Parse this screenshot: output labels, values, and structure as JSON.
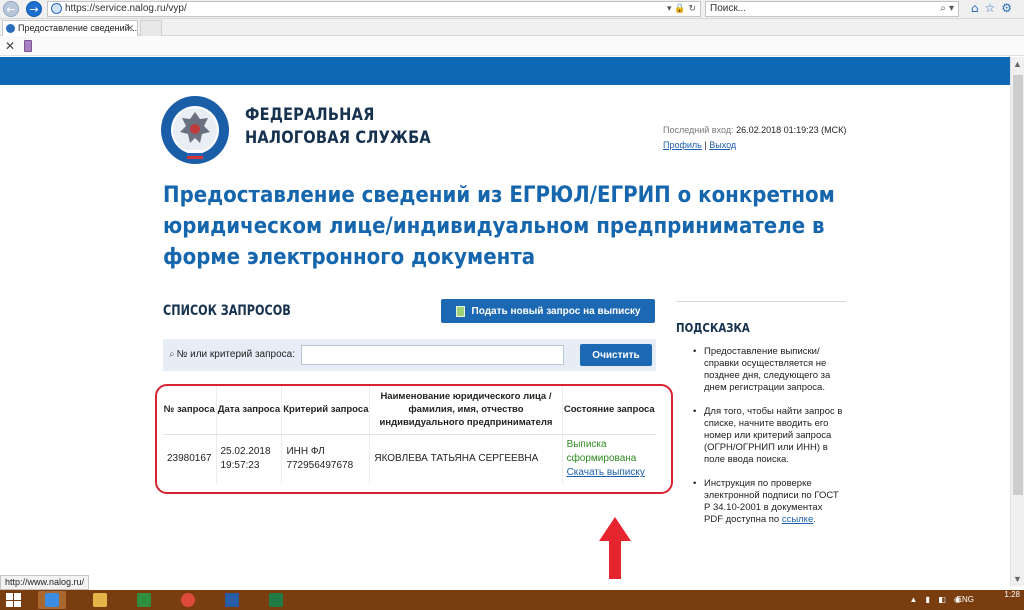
{
  "browser": {
    "url": "https://service.nalog.ru/vyp/",
    "search_placeholder": "Поиск...",
    "tab_title": "Предоставление сведений...",
    "status_url": "http://www.nalog.ru/"
  },
  "header": {
    "org_line1": "ФЕДЕРАЛЬНАЯ",
    "org_line2": "НАЛОГОВАЯ СЛУЖБА",
    "last_login_label": "Последний вход:",
    "last_login_value": "26.02.2018 01:19:23 (МСК)",
    "profile_link": "Профиль",
    "separator": "|",
    "logout_link": "Выход"
  },
  "page_title": "Предоставление сведений из ЕГРЮЛ/ЕГРИП о конкретном юридическом лице/индивидуальном предпринимателе в форме электронного документа",
  "requests": {
    "heading": "СПИСОК ЗАПРОСОВ",
    "new_request_label": "Подать новый запрос на выписку",
    "filter_label": "№ или критерий запроса:",
    "filter_value": "",
    "clear_label": "Очистить",
    "columns": [
      "№ запроса",
      "Дата запроса",
      "Критерий запроса",
      "Наименование юридического лица / фамилия, имя, отчество индивидуального предпринимателя",
      "Состояние запроса"
    ],
    "rows": [
      {
        "number": "23980167",
        "date": "25.02.2018",
        "time": "19:57:23",
        "criterion_type": "ИНН ФЛ",
        "criterion_value": "772956497678",
        "name": "ЯКОВЛЕВА ТАТЬЯНА СЕРГЕЕВНА",
        "status_line1": "Выписка",
        "status_line2": "сформирована",
        "download_link": "Скачать выписку"
      }
    ]
  },
  "hint": {
    "heading": "ПОДСКАЗКА",
    "items": [
      "Предоставление выписки/справки осуществляется не позднее дня, следующего за днем регистрации запроса.",
      "Для того, чтобы найти запрос в списке, начните вводить его номер или критерий запроса (ОГРН/ОГРНИП или ИНН) в поле ввода поиска.",
      "Инструкция по проверке электронной подписи по ГОСТ Р 34.10-2001 в документах PDF доступна по"
    ],
    "link_text": "ссылке",
    "link_suffix": "."
  },
  "taskbar": {
    "time": "1:28",
    "lang": "ENG"
  },
  "colors": {
    "brand_blue": "#0f68b3",
    "button_blue": "#1c68b3",
    "title_blue": "#1666ad",
    "status_green": "#2e8b1e",
    "highlight_red": "#d92230",
    "taskbar": "#7a3d0f"
  }
}
